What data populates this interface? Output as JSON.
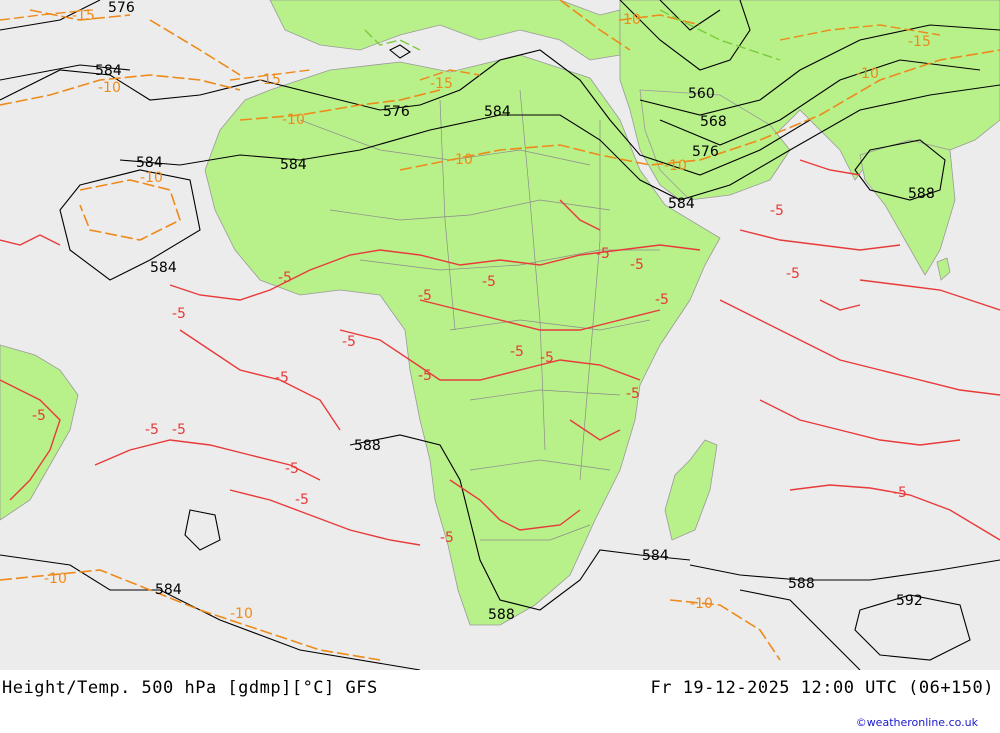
{
  "footer": {
    "title": "Height/Temp. 500 hPa [gdmp][°C] GFS",
    "datetime": "Fr 19-12-2025 12:00 UTC (06+150)",
    "credit": "©weatheronline.co.uk"
  },
  "colors": {
    "ocean": "#ececec",
    "land": "#b8f08a",
    "height_contour": "#000000",
    "temp_minus10": "#ee8a1a",
    "temp_minus5": "#e83a3a",
    "temp_minus15": "#ee8a1a",
    "temp_minus20": "#7acc3a"
  },
  "height_labels": [
    {
      "id": "h1",
      "text": "576"
    },
    {
      "id": "h2",
      "text": "584"
    },
    {
      "id": "h3",
      "text": "584"
    },
    {
      "id": "h4",
      "text": "584"
    },
    {
      "id": "h5",
      "text": "576"
    },
    {
      "id": "h6",
      "text": "584"
    },
    {
      "id": "h7",
      "text": "560"
    },
    {
      "id": "h8",
      "text": "568"
    },
    {
      "id": "h9",
      "text": "576"
    },
    {
      "id": "h10",
      "text": "584"
    },
    {
      "id": "h11",
      "text": "588"
    },
    {
      "id": "h12",
      "text": "584"
    },
    {
      "id": "h13",
      "text": "588"
    },
    {
      "id": "h14",
      "text": "584"
    },
    {
      "id": "h15",
      "text": "584"
    },
    {
      "id": "h16",
      "text": "588"
    },
    {
      "id": "h17",
      "text": "588"
    },
    {
      "id": "h18",
      "text": "592"
    }
  ],
  "temp_labels_minus10": [
    "-10",
    "-10",
    "-10",
    "-10",
    "-10",
    "-10",
    "-10",
    "-10",
    "-10",
    "-10"
  ],
  "temp_labels_minus15": [
    "-15",
    "-15",
    "-15",
    "-15"
  ],
  "temp_labels_minus5": [
    "-5",
    "-5",
    "-5",
    "-5",
    "-5",
    "-5",
    "-5",
    "-5",
    "-5",
    "-5",
    "-5",
    "-5",
    "-5",
    "-5",
    "-5",
    "-5",
    "-5",
    "-5",
    "-5",
    "-5",
    "-5",
    "-5"
  ]
}
